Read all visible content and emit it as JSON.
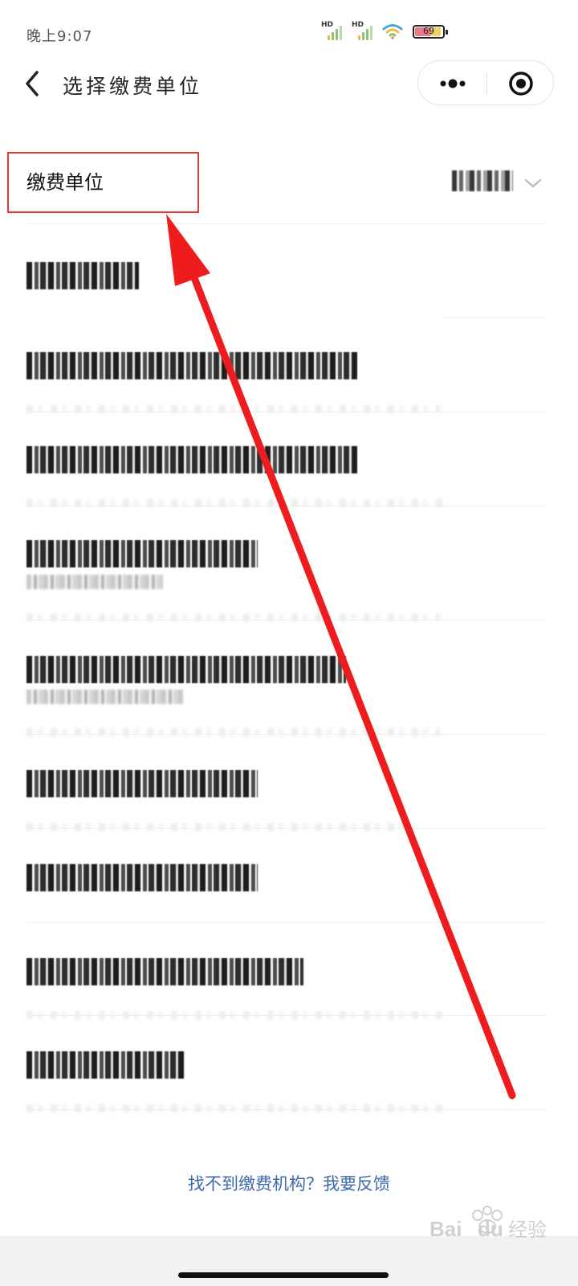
{
  "status_bar": {
    "time": "晚上9:07",
    "signal_1_label": "HD",
    "signal_2_label": "HD",
    "battery_level": "69",
    "wifi_icon": "wifi-icon",
    "battery_icon": "battery-icon"
  },
  "nav": {
    "title": "选择缴费单位",
    "back_icon": "back-arrow-icon",
    "more_icon": "more-icon",
    "close_icon": "target-close-icon"
  },
  "filter": {
    "label": "缴费单位",
    "chevron_icon": "chevron-down-icon"
  },
  "list": {
    "items_count_visible": 9
  },
  "footer": {
    "feedback_link": "找不到缴费机构？我要反馈"
  },
  "colors": {
    "annotation_red": "#e53935",
    "link_blue": "#3f6aa8"
  }
}
